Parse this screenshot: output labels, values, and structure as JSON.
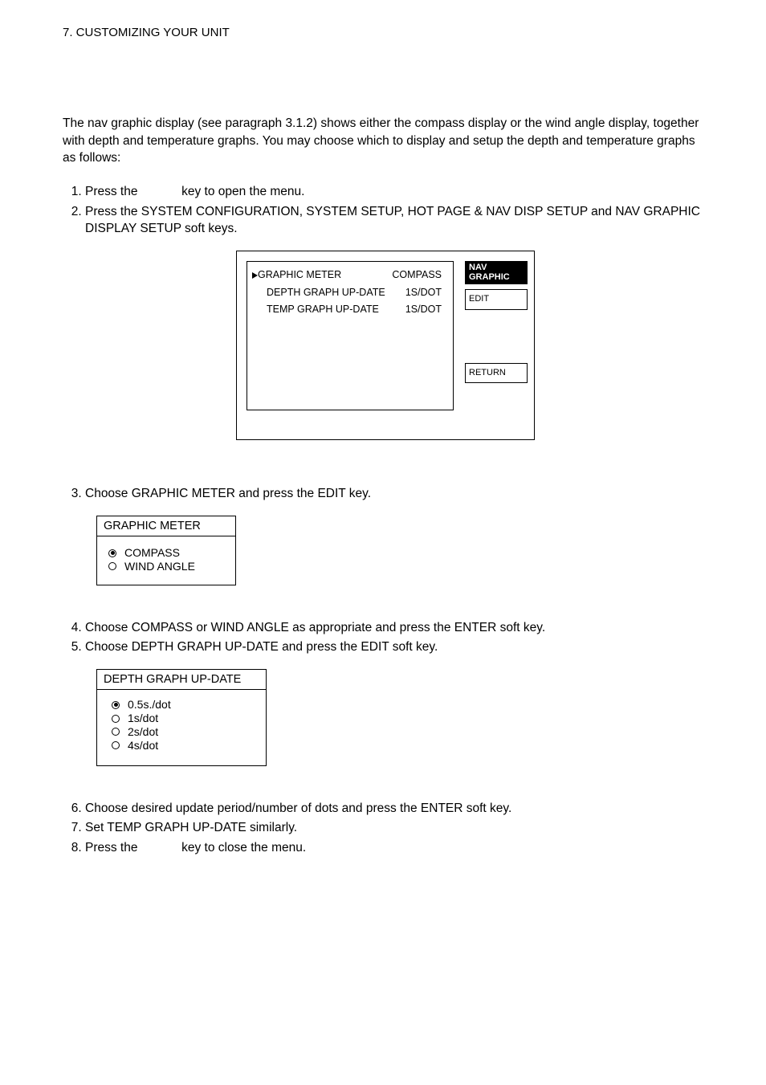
{
  "header": {
    "section_title": "7. CUSTOMIZING YOUR UNIT"
  },
  "intro_paragraph": "The nav graphic display (see paragraph 3.1.2) shows either the compass display or the wind angle display, together with depth and temperature graphs. You may choose which to display and setup the depth and temperature graphs as follows:",
  "steps_top": [
    {
      "pre": "Press the ",
      "mid": "",
      "post": " key to open the menu."
    },
    {
      "pre": "Press the SYSTEM CONFIGURATION, SYSTEM SETUP, HOT PAGE & NAV DISP SETUP and NAV GRAPHIC DISPLAY SETUP soft keys.",
      "mid": "",
      "post": ""
    }
  ],
  "menu_window": {
    "rows": [
      {
        "label": "GRAPHIC METER",
        "value": "COMPASS",
        "pointer": true
      },
      {
        "label": "DEPTH GRAPH UP-DATE",
        "value": "1S/DOT",
        "pointer": false
      },
      {
        "label": "TEMP GRAPH UP-DATE",
        "value": "1S/DOT",
        "pointer": false
      }
    ],
    "sidebar": {
      "title_line1": "NAV",
      "title_line2": "GRAPHIC",
      "edit": "EDIT",
      "return": "RETURN"
    }
  },
  "step3": "Choose GRAPHIC METER and press the EDIT key.",
  "graphic_meter_box": {
    "title": "GRAPHIC METER",
    "options": [
      {
        "label": "COMPASS",
        "selected": true
      },
      {
        "label": "WIND ANGLE",
        "selected": false
      }
    ]
  },
  "step4": "Choose COMPASS or WIND ANGLE as appropriate and press the ENTER soft key.",
  "step5": "Choose DEPTH GRAPH UP-DATE and press the EDIT soft key.",
  "depth_graph_box": {
    "title": "DEPTH GRAPH UP-DATE",
    "options": [
      {
        "label": "0.5s./dot",
        "selected": true
      },
      {
        "label": "1s/dot",
        "selected": false
      },
      {
        "label": "2s/dot",
        "selected": false
      },
      {
        "label": "4s/dot",
        "selected": false
      }
    ]
  },
  "step6": "Choose desired update period/number of dots and press the ENTER soft key.",
  "step7": "Set TEMP GRAPH UP-DATE similarly.",
  "step8_pre": "Press the ",
  "step8_post": " key to close the menu."
}
